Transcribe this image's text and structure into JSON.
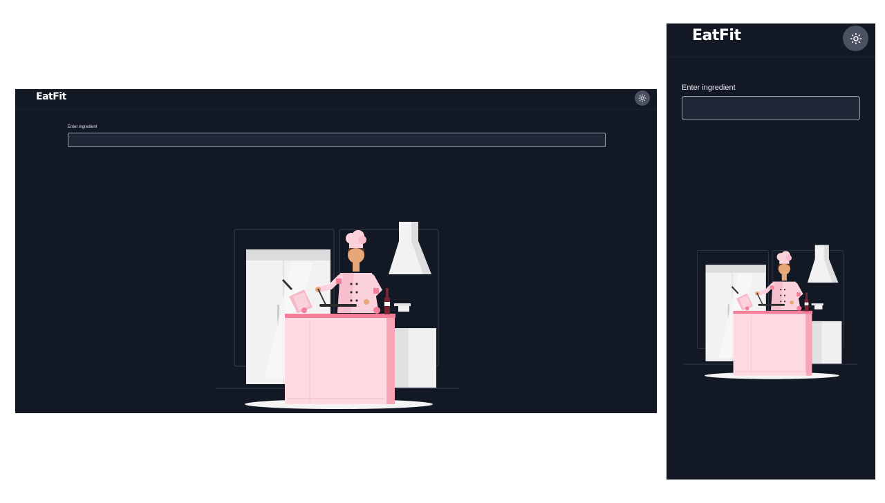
{
  "desktop": {
    "logo": "EatFit",
    "theme_toggle_icon": "sun-icon",
    "ingredient_label": "Enter ingredient",
    "ingredient_value": "",
    "illustration": "chef-cooking-illustration"
  },
  "mobile": {
    "logo": "EatFit",
    "theme_toggle_icon": "sun-icon",
    "ingredient_label": "Enter ingredient",
    "ingredient_value": "",
    "illustration": "chef-cooking-illustration"
  },
  "colors": {
    "background": "#131825",
    "input_background": "#1f2736",
    "input_border": "#9ca3af",
    "toggle_background": "#4b5160",
    "accent_pink": "#fbd6df",
    "accent_pink_dark": "#f57f9b"
  }
}
